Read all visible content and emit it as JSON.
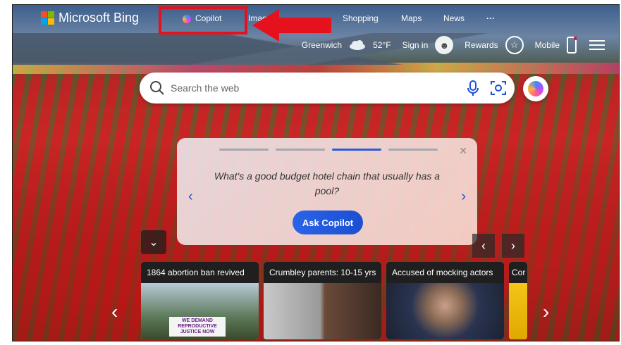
{
  "brand": {
    "name": "Microsoft Bing"
  },
  "nav": {
    "copilot": "Copilot",
    "images": "Imag",
    "shopping": "Shopping",
    "maps": "Maps",
    "news": "News",
    "more": "···"
  },
  "topbar": {
    "location": "Greenwich",
    "temperature": "52°F",
    "signin": "Sign in",
    "rewards": "Rewards",
    "mobile": "Mobile"
  },
  "search": {
    "placeholder": "Search the web"
  },
  "prompt_card": {
    "question": "What's a good budget hotel chain that usually has a pool?",
    "button": "Ask Copilot",
    "active_step": 3,
    "total_steps": 4
  },
  "news": [
    {
      "title": "1864 abortion ban revived",
      "sign": "WE DEMAND REPRODUCTIVE JUSTICE NOW"
    },
    {
      "title": "Crumbley parents: 10-15 yrs"
    },
    {
      "title": "Accused of mocking actors"
    },
    {
      "title": "Cor"
    }
  ],
  "colors": {
    "accent": "#2b5bd7",
    "highlight": "#e5121e"
  }
}
